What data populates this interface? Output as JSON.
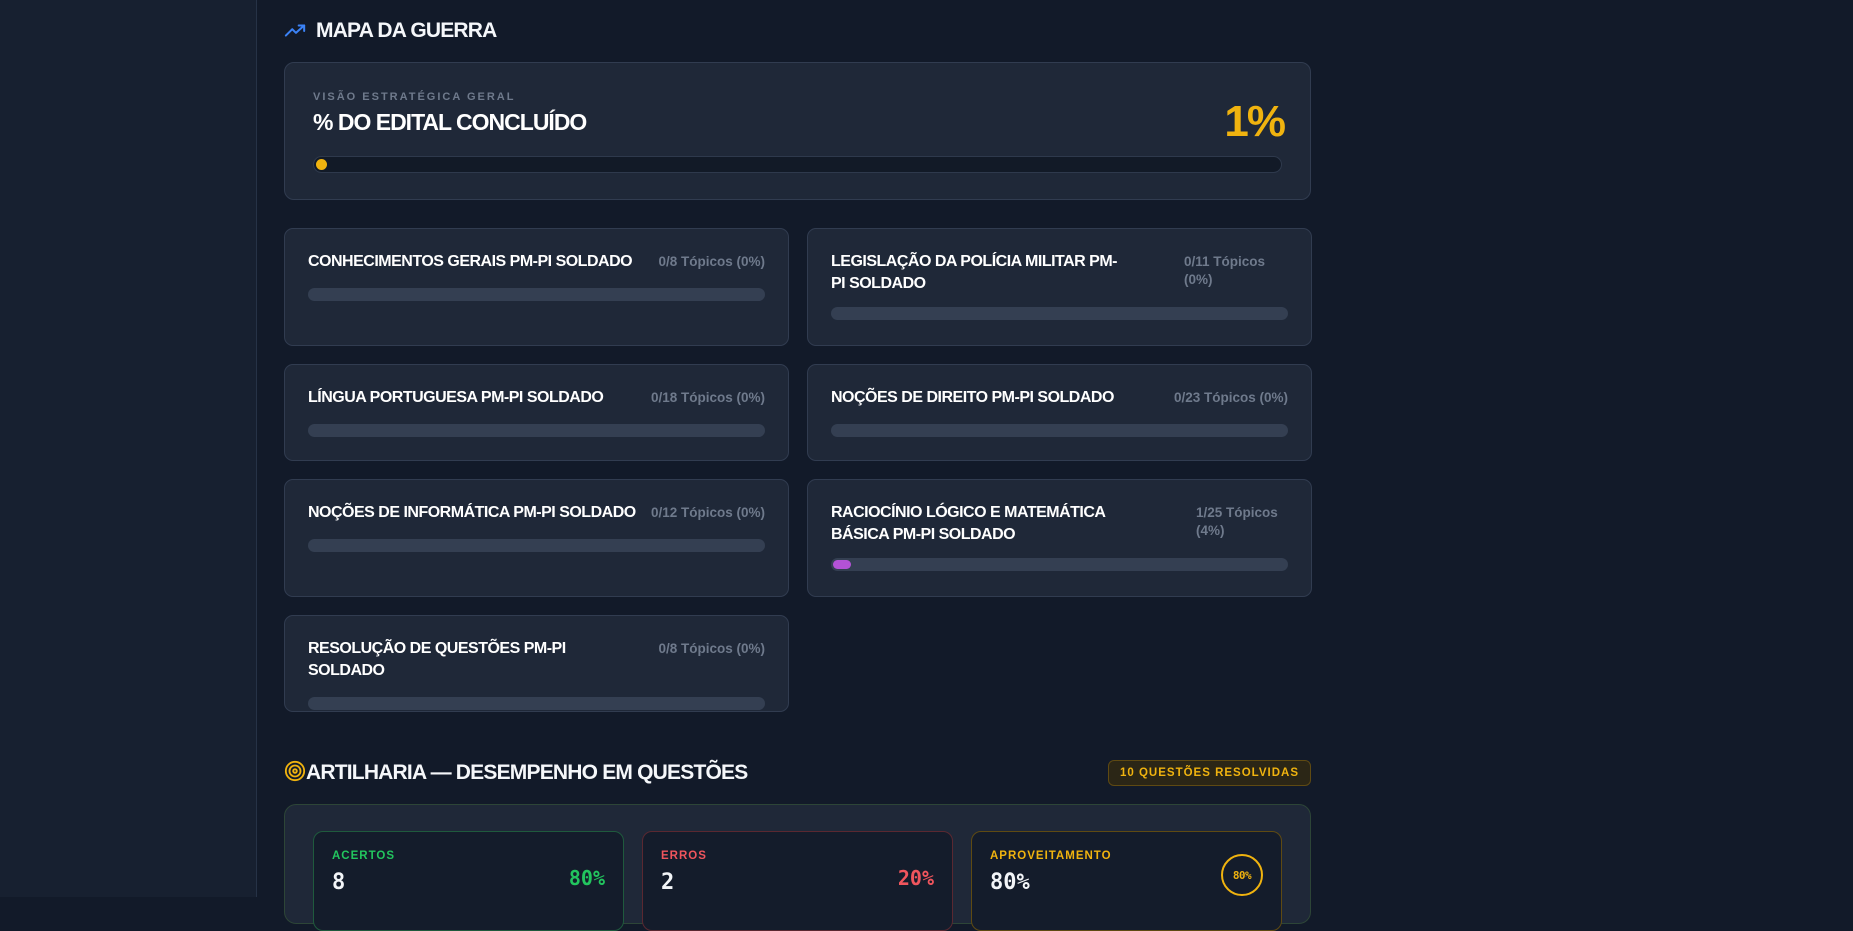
{
  "colors": {
    "background": "#121a29",
    "card": "#1f2838",
    "accent": "#f0b30f",
    "blue": "#3b82f6",
    "purple": "#b352d6",
    "green": "#22c55e",
    "red": "#f0555d",
    "muted": "#6f7a8c"
  },
  "war_map": {
    "icon": "trending-up-icon",
    "title": "MAPA DA GUERRA"
  },
  "overview": {
    "eyebrow": "VISÃO ESTRATÉGICA GERAL",
    "title": "% DO EDITAL CONCLUÍDO",
    "percent_label": "1%",
    "progress": 0.01
  },
  "subjects": [
    {
      "title": "CONHECIMENTOS GERAIS PM-PI SOLDADO",
      "count_label": "0/8 Tópicos (0%)",
      "progress": 0
    },
    {
      "title": "LEGISLAÇÃO DA POLÍCIA MILITAR PM-PI SOLDADO",
      "count_label": "0/11 Tópicos (0%)",
      "progress": 0
    },
    {
      "title": "LÍNGUA PORTUGUESA PM-PI SOLDADO",
      "count_label": "0/18 Tópicos (0%)",
      "progress": 0
    },
    {
      "title": "NOÇÕES DE DIREITO PM-PI SOLDADO",
      "count_label": "0/23 Tópicos (0%)",
      "progress": 0
    },
    {
      "title": "NOÇÕES DE INFORMÁTICA PM-PI SOLDADO",
      "count_label": "0/12 Tópicos (0%)",
      "progress": 0
    },
    {
      "title": "RACIOCÍNIO LÓGICO E MATEMÁTICA BÁSICA PM-PI SOLDADO",
      "count_label": "1/25 Tópicos (4%)",
      "progress": 0.04
    },
    {
      "title": "RESOLUÇÃO DE QUESTÕES PM-PI SOLDADO",
      "count_label": "0/8 Tópicos (0%)",
      "progress": 0
    }
  ],
  "artillery": {
    "icon": "target-icon",
    "title": "ARTILHARIA — DESEMPENHO EM QUESTÕES",
    "badge": "10 QUESTÕES RESOLVIDAS",
    "stats": {
      "hits": {
        "label": "ACERTOS",
        "value": "8",
        "percent": "80%"
      },
      "errors": {
        "label": "ERROS",
        "value": "2",
        "percent": "20%"
      },
      "performance": {
        "label": "APROVEITAMENTO",
        "value": "80%",
        "ring_label": "80%",
        "progress": 0.8
      }
    }
  }
}
